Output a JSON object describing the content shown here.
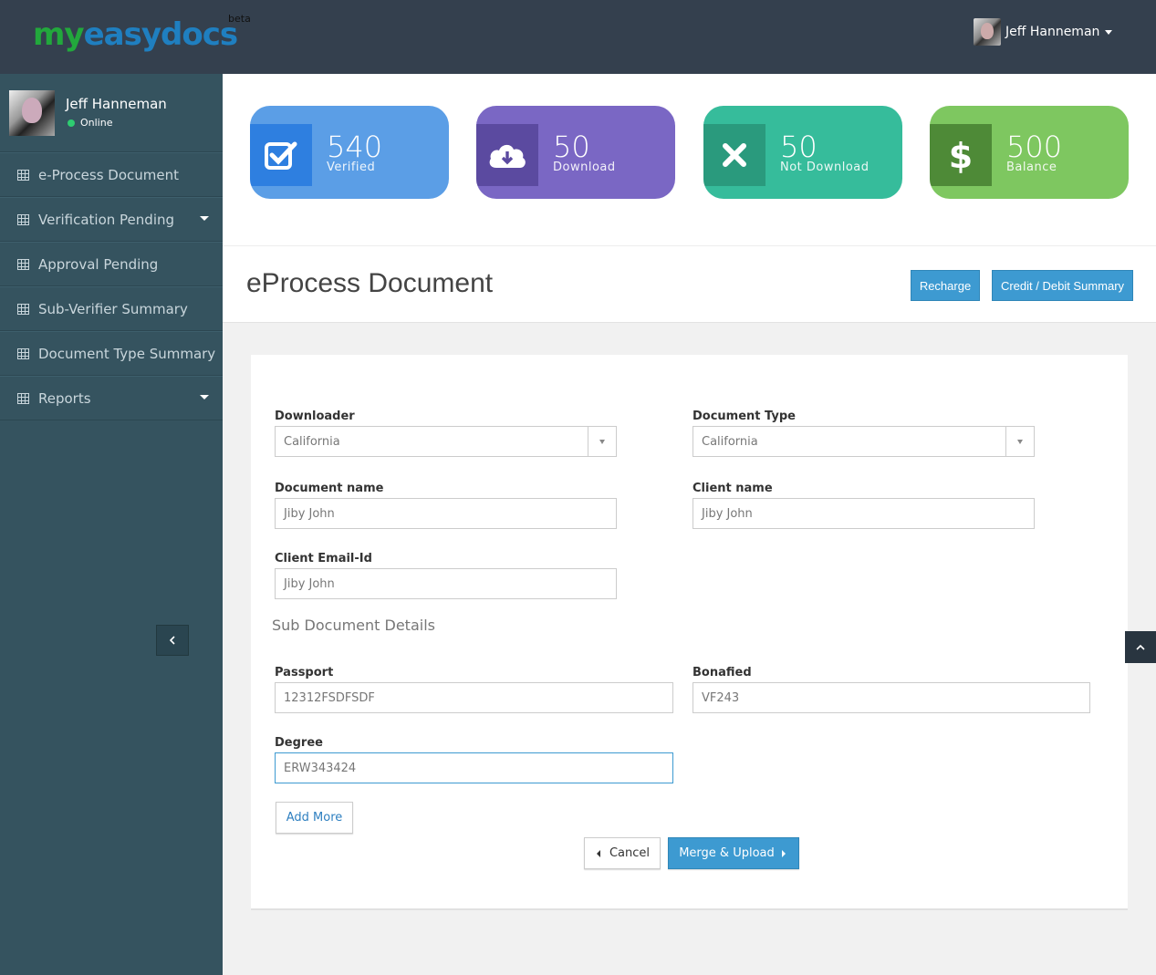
{
  "brand": {
    "logo_part1": "my",
    "logo_part2": "easydocs",
    "beta": "beta"
  },
  "topbar": {
    "user_name": "Jeff Hanneman"
  },
  "sidebar": {
    "user_name": "Jeff Hanneman",
    "status": "Online",
    "items": [
      {
        "label": "e-Process Document",
        "has_caret": false
      },
      {
        "label": "Verification Pending",
        "has_caret": true
      },
      {
        "label": "Approval Pending",
        "has_caret": false
      },
      {
        "label": "Sub-Verifier Summary",
        "has_caret": false
      },
      {
        "label": "Document Type Summary",
        "has_caret": false
      },
      {
        "label": "Reports",
        "has_caret": true
      }
    ]
  },
  "stats": [
    {
      "value": "540",
      "label": "Verified",
      "icon": "check-square-icon",
      "color": "#5b9ee6",
      "icon_bg": "#2e7fe0"
    },
    {
      "value": "50",
      "label": "Download",
      "icon": "cloud-download-icon",
      "color": "#7a67c4",
      "icon_bg": "#5b4aa0"
    },
    {
      "value": "50",
      "label": "Not Download",
      "icon": "close-icon",
      "color": "#36bc9b",
      "icon_bg": "#2a9a7d"
    },
    {
      "value": "500",
      "label": "Balance",
      "icon": "dollar-icon",
      "color": "#7ec760",
      "icon_bg": "#4e8a37"
    }
  ],
  "page": {
    "title": "eProcess Document",
    "recharge_label": "Recharge",
    "summary_label": "Credit / Debit Summary"
  },
  "form": {
    "downloader_label": "Downloader",
    "downloader_value": "California",
    "doctype_label": "Document Type",
    "doctype_value": "California",
    "docname_label": "Document name",
    "docname_value": "Jiby John",
    "client_label": "Client name",
    "client_value": "Jiby John",
    "email_label": "Client Email-Id",
    "email_value": "Jiby John",
    "sub_title": "Sub Document Details",
    "passport_label": "Passport",
    "passport_value": "12312FSDFSDF",
    "bonafied_label": "Bonafied",
    "bonafied_value": "VF243",
    "degree_label": "Degree",
    "degree_value": "ERW343424",
    "add_more_label": "Add More",
    "cancel_label": "Cancel",
    "merge_label": "Merge & Upload"
  },
  "colors": {
    "topbar": "#34404e",
    "sidebar": "#35535f",
    "accent": "#3d9ad1"
  }
}
